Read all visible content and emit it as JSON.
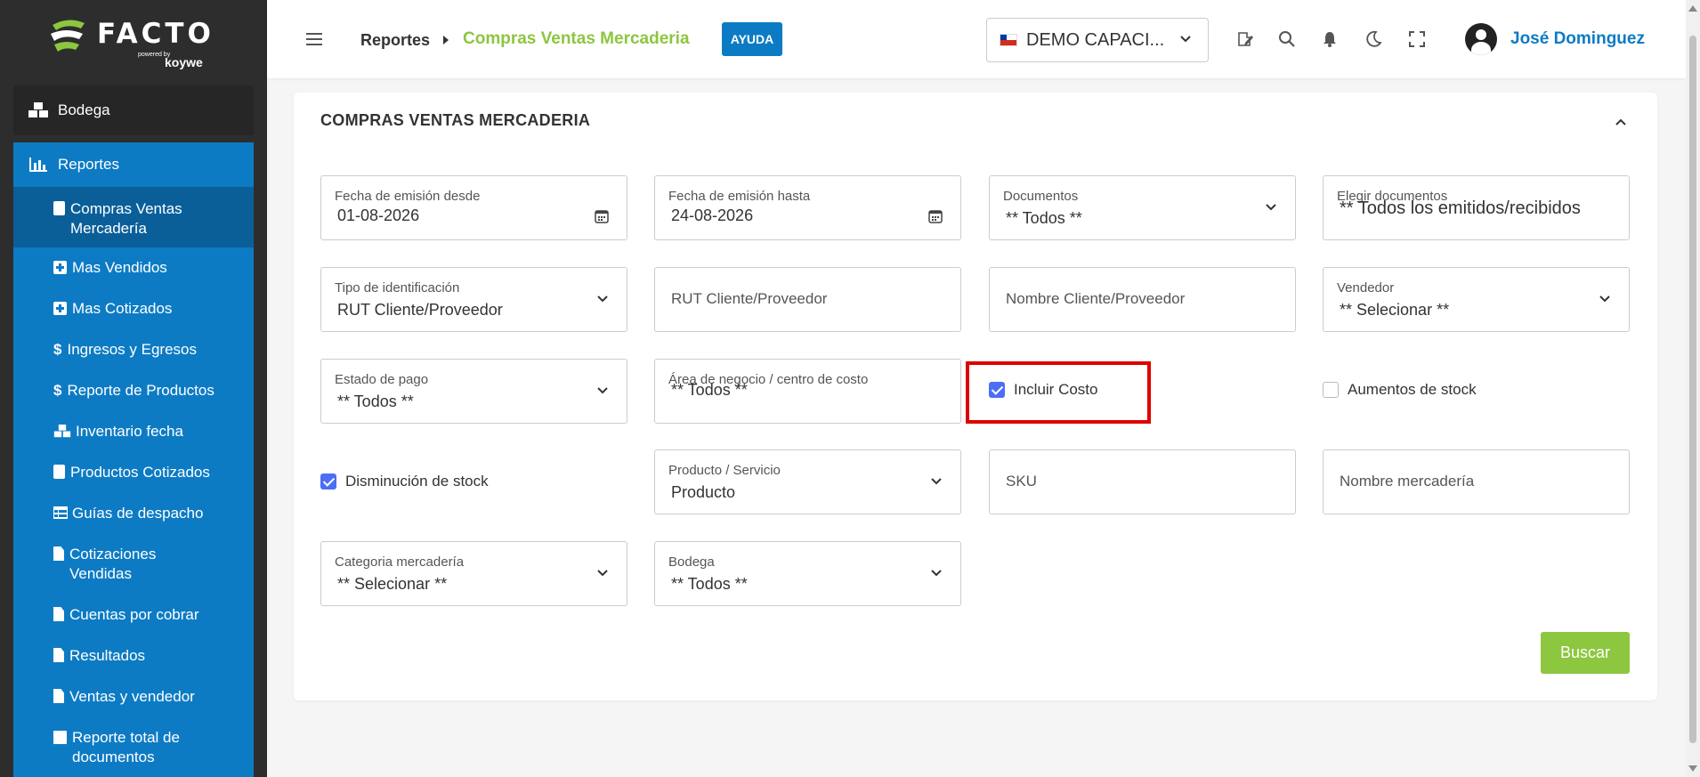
{
  "sidebar": {
    "logo": {
      "brand": "FACTO",
      "powered": "powered by",
      "sub": "koywe"
    },
    "bodega_label": "Bodega",
    "section_label": "Reportes",
    "items": [
      {
        "label": "Compras Ventas Mercadería",
        "icon": "calculator-icon"
      },
      {
        "label": "Mas Vendidos",
        "icon": "plus-square-icon"
      },
      {
        "label": "Mas Cotizados",
        "icon": "plus-square-icon"
      },
      {
        "label": "Ingresos y Egresos",
        "icon": "dollar-icon"
      },
      {
        "label": "Reporte de Productos",
        "icon": "dollar-icon"
      },
      {
        "label": "Inventario fecha",
        "icon": "cubes-icon"
      },
      {
        "label": "Productos Cotizados",
        "icon": "calculator-icon"
      },
      {
        "label": "Guías de despacho",
        "icon": "table-icon"
      },
      {
        "label": "Cotizaciones Vendidas",
        "icon": "file-icon"
      },
      {
        "label": "Cuentas por cobrar",
        "icon": "file-icon"
      },
      {
        "label": "Resultados",
        "icon": "file-icon"
      },
      {
        "label": "Ventas y vendedor",
        "icon": "file-icon"
      },
      {
        "label": "Reporte total de documentos",
        "icon": "archive-icon"
      }
    ]
  },
  "topbar": {
    "crumb_parent": "Reportes",
    "crumb_current": "Compras Ventas Mercaderia",
    "help_label": "AYUDA",
    "company": "DEMO CAPACI...",
    "user_name": "José Dominguez"
  },
  "card": {
    "title": "COMPRAS VENTAS MERCADERIA",
    "fields": {
      "fecha_desde": {
        "label": "Fecha de emisión desde",
        "value": "01-08-2026"
      },
      "fecha_hasta": {
        "label": "Fecha de emisión hasta",
        "value": "24-08-2026"
      },
      "documentos": {
        "label": "Documentos",
        "value": "** Todos **"
      },
      "elegir_documentos": {
        "label": "Elegir documentos",
        "value": "** Todos los emitidos/recibidos"
      },
      "tipo_identificacion": {
        "label": "Tipo de identificación",
        "value": "RUT Cliente/Proveedor"
      },
      "rut": {
        "placeholder": "RUT Cliente/Proveedor"
      },
      "nombre_cliente": {
        "placeholder": "Nombre Cliente/Proveedor"
      },
      "vendedor": {
        "label": "Vendedor",
        "value": "** Selecionar **"
      },
      "estado_pago": {
        "label": "Estado de pago",
        "value": "** Todos **"
      },
      "area_negocio": {
        "label": "Área de negocio / centro de costo",
        "value": "** Todos **"
      },
      "producto_servicio": {
        "label": "Producto / Servicio",
        "value": "Producto"
      },
      "sku": {
        "placeholder": "SKU"
      },
      "nombre_mercaderia": {
        "placeholder": "Nombre mercadería"
      },
      "categoria": {
        "label": "Categoria mercadería",
        "value": "** Selecionar **"
      },
      "bodega": {
        "label": "Bodega",
        "value": "** Todos **"
      }
    },
    "checkboxes": {
      "incluir_costo": {
        "label": "Incluir Costo",
        "checked": true
      },
      "aumentos_stock": {
        "label": "Aumentos de stock",
        "checked": false
      },
      "disminucion_stock": {
        "label": "Disminución de stock",
        "checked": true
      }
    },
    "search_label": "Buscar"
  },
  "colors": {
    "accent_blue": "#0d7bc4",
    "accent_green": "#8dc63f",
    "highlight_red": "#d00000"
  }
}
